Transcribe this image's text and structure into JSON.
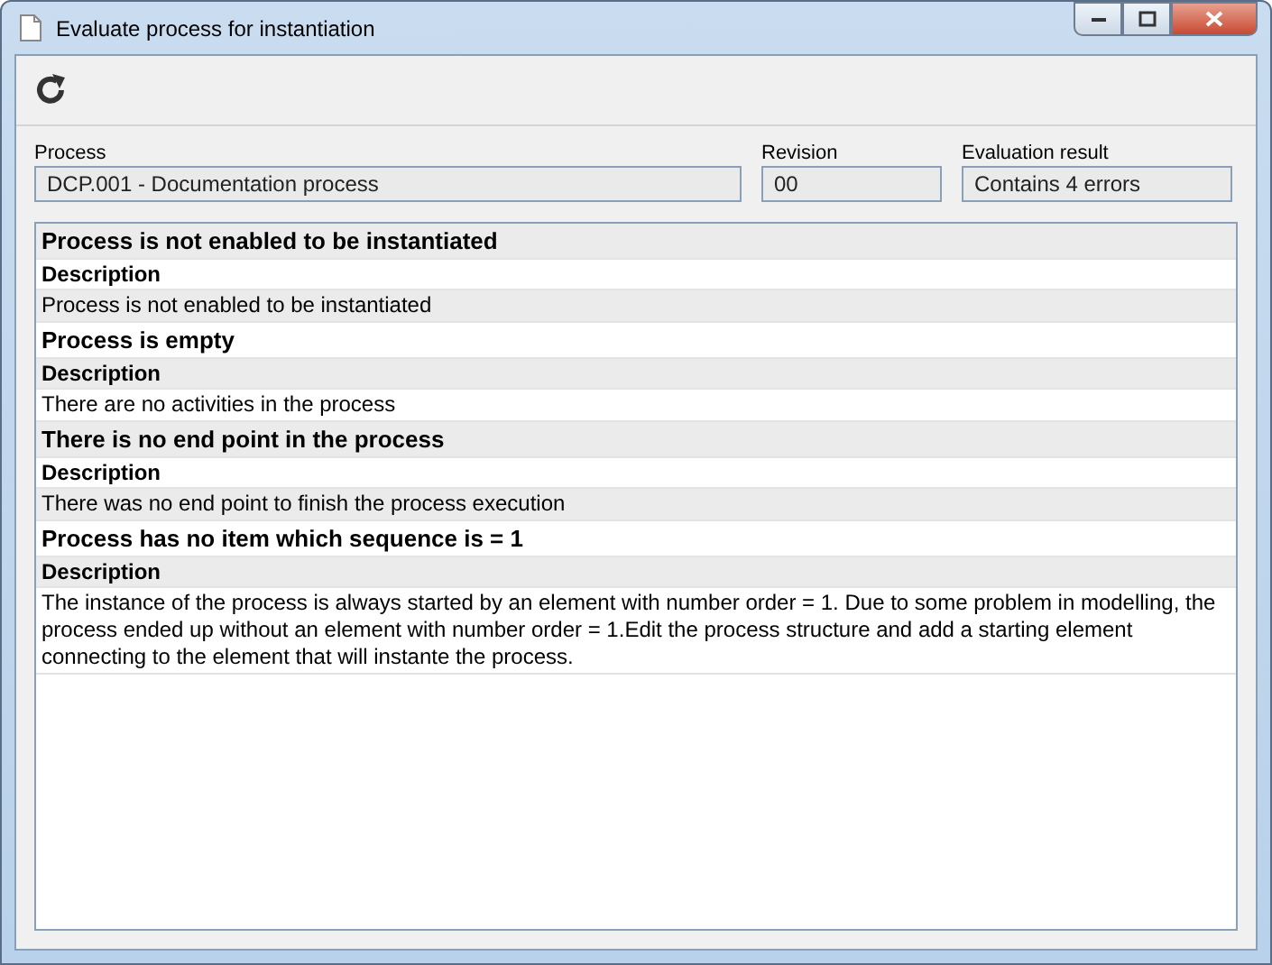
{
  "window": {
    "title": "Evaluate process for instantiation"
  },
  "fields": [
    {
      "label": "Process",
      "value": "DCP.001 - Documentation process"
    },
    {
      "label": "Revision",
      "value": "00"
    },
    {
      "label": "Evaluation result",
      "value": "Contains 4 errors"
    }
  ],
  "errors": [
    {
      "title": "Process is not enabled to be instantiated",
      "description_label": "Description",
      "description": "Process is not enabled to be instantiated"
    },
    {
      "title": "Process is empty",
      "description_label": "Description",
      "description": "There are no activities in the process"
    },
    {
      "title": "There is no end point in the process",
      "description_label": "Description",
      "description": "There was no end point to finish the process execution"
    },
    {
      "title": "Process has no item which sequence is = 1",
      "description_label": "Description",
      "description": "The instance of the process is always started by an element with number order = 1. Due to some problem in modelling, the process ended up without an element with number order = 1.Edit the process structure and add a starting element connecting to the element that will instante the process."
    }
  ]
}
